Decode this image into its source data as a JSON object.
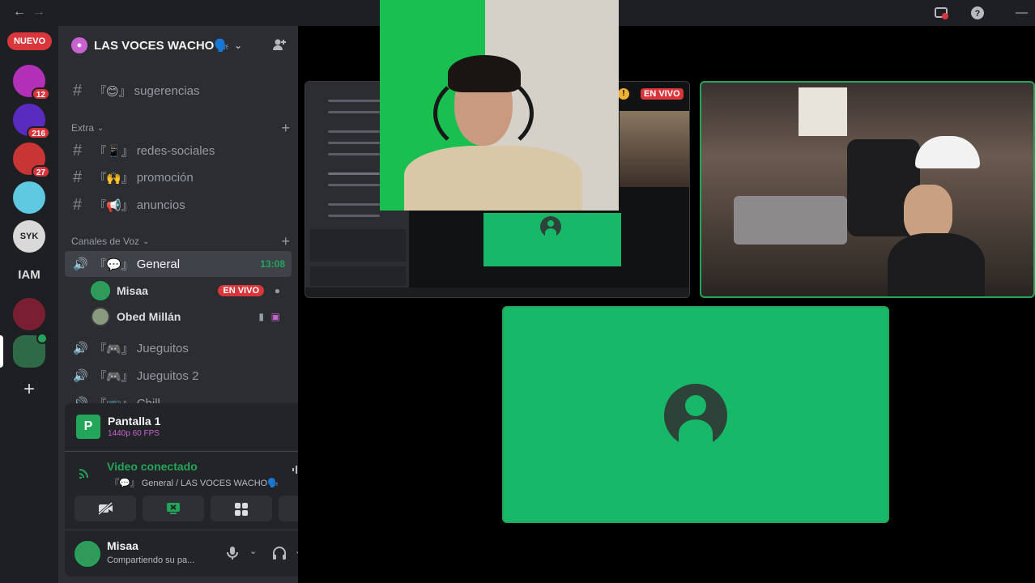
{
  "rail": {
    "nuevo_label": "NUEVO",
    "servers": [
      {
        "name": "server-1",
        "badge": "12",
        "color": "#b32fb8"
      },
      {
        "name": "server-2",
        "badge": "216",
        "color": "#5a2bbf"
      },
      {
        "name": "server-creator",
        "badge": "27",
        "color": "#c93535"
      },
      {
        "name": "server-4",
        "badge": "",
        "color": "#5ec9e0"
      },
      {
        "name": "server-syk",
        "label": "SYK",
        "color": "#d9d9d9"
      },
      {
        "name": "server-iam",
        "label": "IAM"
      },
      {
        "name": "server-7",
        "badge": "",
        "color": "#7a1f33"
      },
      {
        "name": "server-voces",
        "badge": "",
        "color": "#2f6a46"
      }
    ]
  },
  "sidebar": {
    "server_name": "LAS VOCES WACHO🗣️",
    "channels_top": [
      {
        "emoji": "『😊』",
        "name": "sugerencias"
      }
    ],
    "category_extra": "Extra",
    "extra_channels": [
      {
        "emoji": "『📱』",
        "name": "redes-sociales"
      },
      {
        "emoji": "『🙌』",
        "name": "promoción"
      },
      {
        "emoji": "『📢』",
        "name": "anuncios"
      }
    ],
    "category_voice": "Canales de Voz",
    "voice_channels": [
      {
        "emoji": "『💬』",
        "name": "General",
        "time": "13:08",
        "active": true
      },
      {
        "emoji": "『🎮』",
        "name": "Jueguitos"
      },
      {
        "emoji": "『🎮』",
        "name": "Jueguitos 2"
      },
      {
        "emoji": "『📺』",
        "name": "Chill"
      }
    ],
    "voice_users": [
      {
        "name": "Misaa",
        "live": "EN VIVO"
      },
      {
        "name": "Obed Millán"
      }
    ]
  },
  "screen_panel": {
    "title": "Pantalla 1",
    "subtitle": "1440p 60 FPS"
  },
  "connection": {
    "title": "Video conectado",
    "subtitle": "『💬』 General / LAS VOCES WACHO🗣️"
  },
  "user": {
    "name": "Misaa",
    "status": "Compartiendo su pa..."
  },
  "stage": {
    "live_label": "EN VIVO"
  },
  "colors": {
    "accent_green": "#23a55a",
    "live_red": "#da373c",
    "tile_green": "#17b868"
  }
}
